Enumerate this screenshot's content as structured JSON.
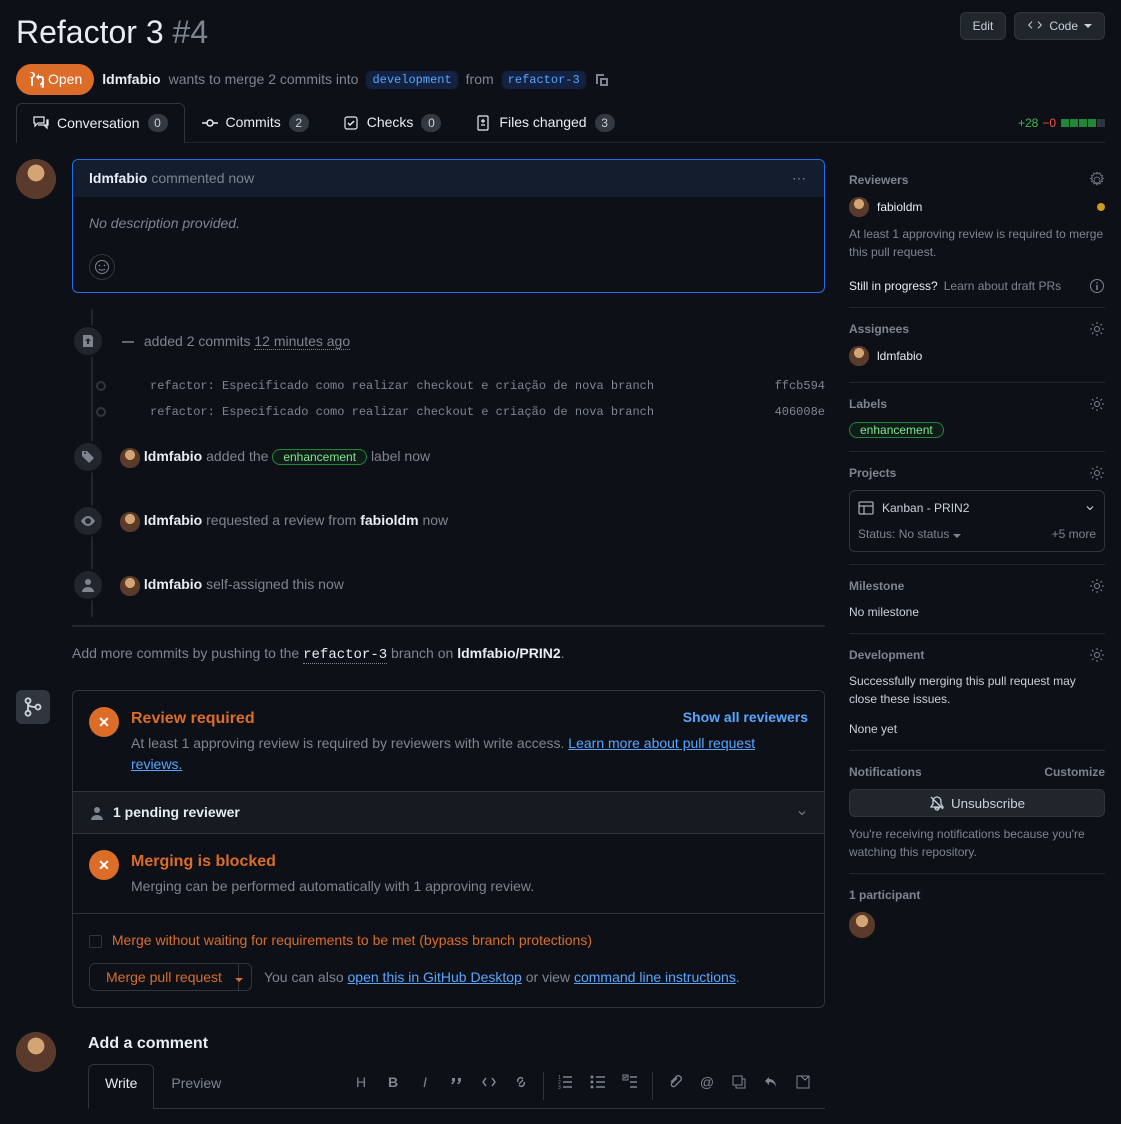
{
  "header": {
    "title": "Refactor 3",
    "number": "#4",
    "edit_btn": "Edit",
    "code_btn": "Code"
  },
  "meta": {
    "status": "Open",
    "author": "ldmfabio",
    "wants": "wants to merge 2 commits into",
    "base_branch": "development",
    "from": "from",
    "head_branch": "refactor-3"
  },
  "tabs": {
    "conversation": "Conversation",
    "conversation_count": "0",
    "commits": "Commits",
    "commits_count": "2",
    "checks": "Checks",
    "checks_count": "0",
    "files": "Files changed",
    "files_count": "3",
    "diff_add": "+28",
    "diff_del": "−0"
  },
  "first_comment": {
    "author": "ldmfabio",
    "when": "commented now",
    "body": "No description provided."
  },
  "timeline": {
    "added_commits": "added 2 commits",
    "added_when": "12 minutes ago",
    "commits": [
      {
        "msg": "refactor: Especificado como realizar checkout e criação de nova branch",
        "sha": "ffcb594"
      },
      {
        "msg": "refactor: Especificado como realizar checkout e criação de nova branch",
        "sha": "406008e"
      }
    ],
    "label_event": {
      "author": "ldmfabio",
      "action": "added the",
      "label": "enhancement",
      "suffix": "label now"
    },
    "review_event": {
      "author": "ldmfabio",
      "action": "requested a review from",
      "reviewer": "fabioldm",
      "when": "now"
    },
    "assign_event": {
      "author": "ldmfabio",
      "action": "self-assigned this now"
    }
  },
  "push_hint": {
    "prefix": "Add more commits by pushing to the",
    "branch": "refactor-3",
    "mid": "branch on",
    "repo": "ldmfabio/PRIN2"
  },
  "merge": {
    "review_title": "Review required",
    "review_sub": "At least 1 approving review is required by reviewers with write access.",
    "review_link": "Learn more about pull request reviews.",
    "show_reviewers": "Show all reviewers",
    "pending": "1 pending reviewer",
    "blocked_title": "Merging is blocked",
    "blocked_sub": "Merging can be performed automatically with 1 approving review.",
    "bypass": "Merge without waiting for requirements to be met (bypass branch protections)",
    "merge_btn": "Merge pull request",
    "also": "You can also",
    "open_desktop": "open this in GitHub Desktop",
    "or_view": "or view",
    "cmdline": "command line instructions"
  },
  "composer": {
    "heading": "Add a comment",
    "write": "Write",
    "preview": "Preview"
  },
  "sidebar": {
    "reviewers": {
      "title": "Reviewers",
      "name": "fabioldm",
      "note": "At least 1 approving review is required to merge this pull request.",
      "draft_q": "Still in progress?",
      "draft_link": "Learn about draft PRs"
    },
    "assignees": {
      "title": "Assignees",
      "name": "ldmfabio"
    },
    "labels": {
      "title": "Labels",
      "label": "enhancement"
    },
    "projects": {
      "title": "Projects",
      "name": "Kanban - PRIN2",
      "status": "Status: No status",
      "more": "+5 more"
    },
    "milestone": {
      "title": "Milestone",
      "none": "No milestone"
    },
    "dev": {
      "title": "Development",
      "note": "Successfully merging this pull request may close these issues.",
      "none": "None yet"
    },
    "notif": {
      "title": "Notifications",
      "customize": "Customize",
      "unsub": "Unsubscribe",
      "note": "You're receiving notifications because you're watching this repository."
    },
    "participants": {
      "title": "1 participant"
    }
  }
}
